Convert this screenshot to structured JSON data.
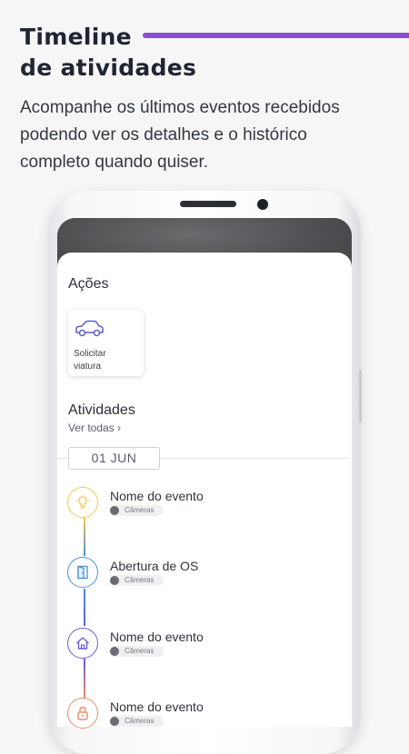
{
  "header": {
    "title_line1": "Timeline",
    "title_line2": "de atividades",
    "description_line1": "Acompanhe os últimos eventos recebidos",
    "description_line2": "podendo ver os detalhes e o histórico",
    "description_line3": "completo quando quiser.",
    "accent_color": "#8b4fd6"
  },
  "app": {
    "actions_title": "Ações",
    "action_card": {
      "label_line1": "Solicitar",
      "label_line2": "viatura",
      "icon": "car-icon"
    },
    "activities_title": "Atividades",
    "see_all": "Ver todas",
    "date_label": "01 JUN",
    "events": [
      {
        "title": "Nome do evento",
        "tag": "Câmeras",
        "icon": "lightbulb-icon",
        "color": "#f2c94c"
      },
      {
        "title": "Abertura de OS",
        "tag": "Câmeras",
        "icon": "door-icon",
        "color": "#4a90d9"
      },
      {
        "title": "Nome do evento",
        "tag": "Câmeras",
        "icon": "home-icon",
        "color": "#6b5bd6"
      },
      {
        "title": "Nome do evento",
        "tag": "Câmeras",
        "icon": "lock-icon",
        "color": "#f08a6a"
      }
    ]
  }
}
